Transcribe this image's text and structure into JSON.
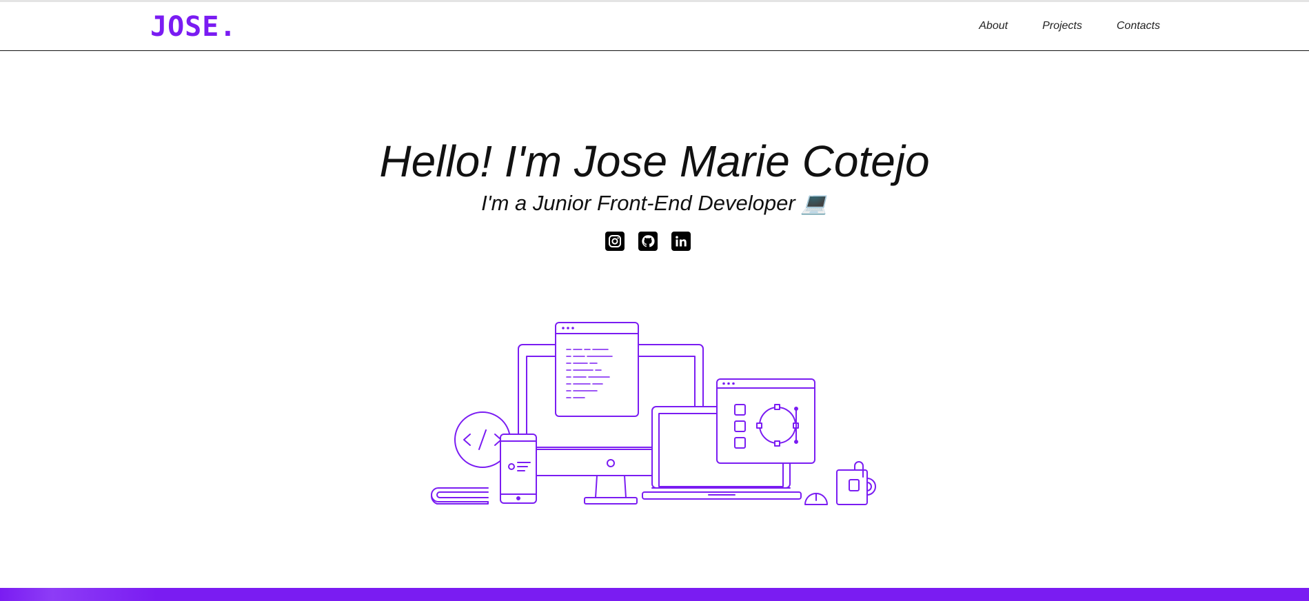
{
  "header": {
    "logo": "JOSE.",
    "nav": [
      {
        "label": "About"
      },
      {
        "label": "Projects"
      },
      {
        "label": "Contacts"
      }
    ]
  },
  "hero": {
    "title": "Hello! I'm Jose Marie Cotejo",
    "subtitle": "I'm a Junior Front-End Developer 💻"
  },
  "socials": [
    {
      "icon": "instagram-icon"
    },
    {
      "icon": "github-icon"
    },
    {
      "icon": "linkedin-icon"
    }
  ],
  "colors": {
    "brand": "#7a1cf2",
    "text": "#111111",
    "background": "#ffffff"
  }
}
